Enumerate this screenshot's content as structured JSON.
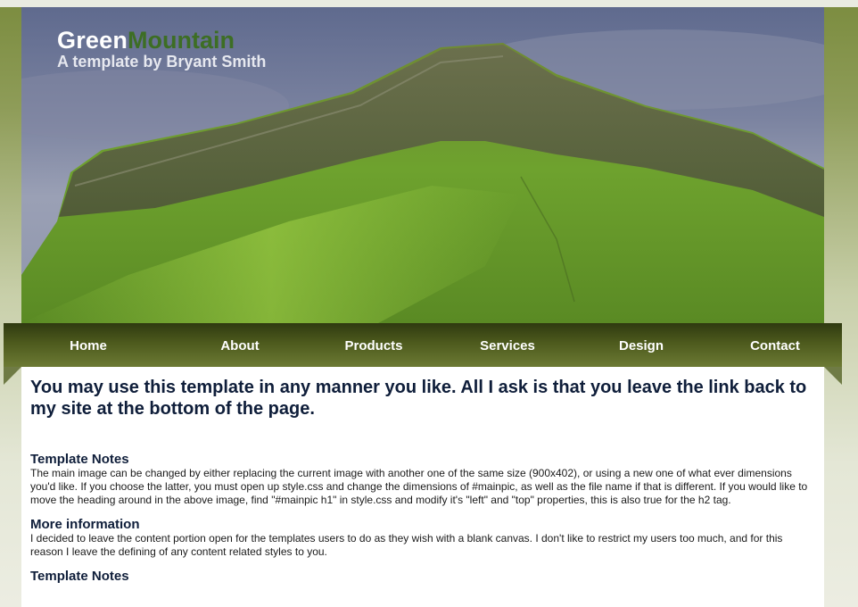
{
  "header": {
    "logo_part1": "Green",
    "logo_part2": "Mountain",
    "subtitle": "A template by Bryant Smith"
  },
  "nav": {
    "items": [
      "Home",
      "About",
      "Products",
      "Services",
      "Design",
      "Contact"
    ]
  },
  "content": {
    "headline": "You may use this template in any manner you like. All I ask is that you leave the link back to my site at the bottom of the page.",
    "sections": [
      {
        "title": "Template Notes",
        "body": "The main image can be changed by either replacing the current image with another one of the same size (900x402), or using a new one of what ever dimensions you'd like. If you choose the latter, you must open up style.css and change the dimensions of #mainpic, as well as the file name if that is different. If you would like to move the heading around in the above image, find \"#mainpic h1\" in style.css and modify it's \"left\" and \"top\" properties, this is also true for the h2 tag."
      },
      {
        "title": "More information",
        "body": "I decided to leave the content portion open for the templates users to do as they wish with a blank canvas. I don't like to restrict my users too much, and for this reason I leave the defining of any content related styles to you."
      },
      {
        "title": "Template Notes",
        "body": ""
      }
    ]
  },
  "colors": {
    "logo_accent": "#3d6e24",
    "nav_bg": "#4d5a1d",
    "heading_text": "#0f1e3a"
  }
}
